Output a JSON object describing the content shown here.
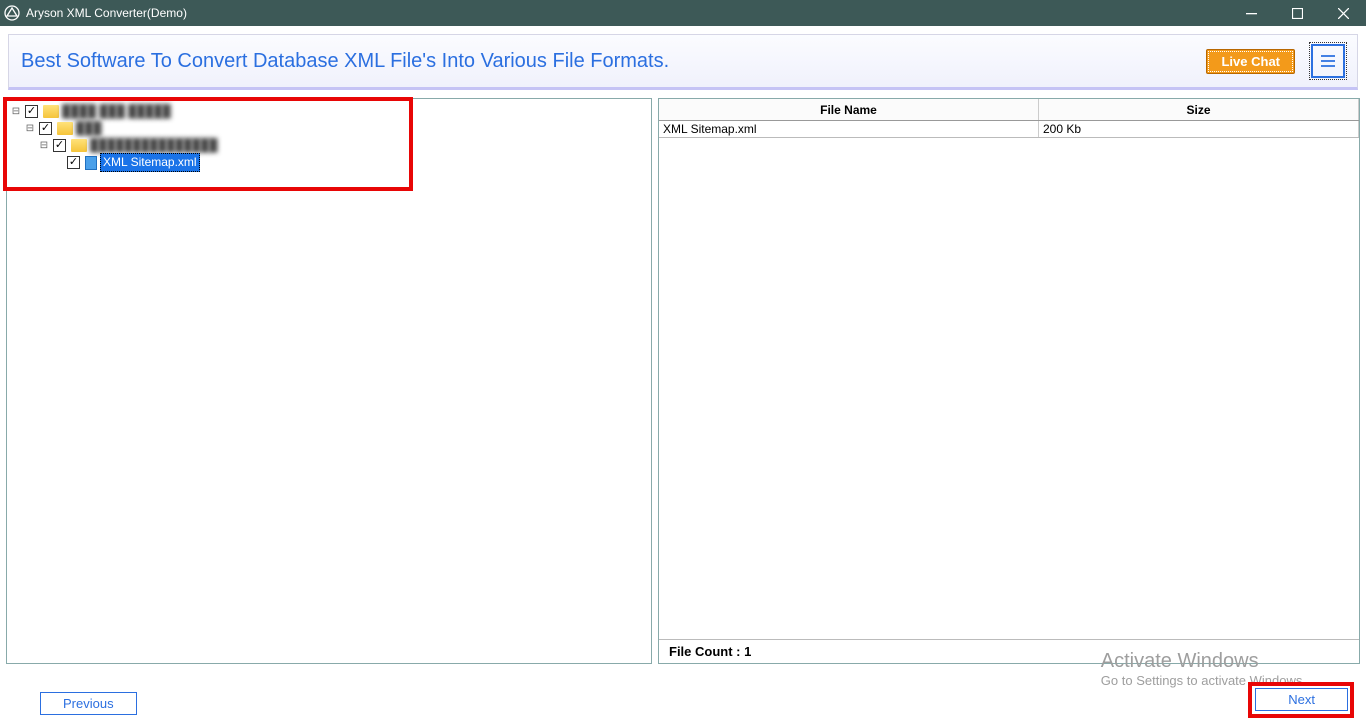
{
  "titlebar": {
    "title": "Aryson XML Converter(Demo)"
  },
  "banner": {
    "headline": "Best Software To Convert Database XML File's Into Various File Formats.",
    "live_chat": "Live Chat"
  },
  "tree": {
    "node0_label": "████ ███ █████",
    "node1_label": "███",
    "node2_label": "███████████████",
    "node3_label": "XML Sitemap.xml"
  },
  "table": {
    "col_name": "File Name",
    "col_size": "Size",
    "rows": [
      {
        "name": "XML Sitemap.xml",
        "size": "200 Kb"
      }
    ],
    "file_count_label": "File Count : 1"
  },
  "buttons": {
    "previous": "Previous",
    "next": "Next"
  },
  "watermark": {
    "line1": "Activate Windows",
    "line2": "Go to Settings to activate Windows."
  }
}
